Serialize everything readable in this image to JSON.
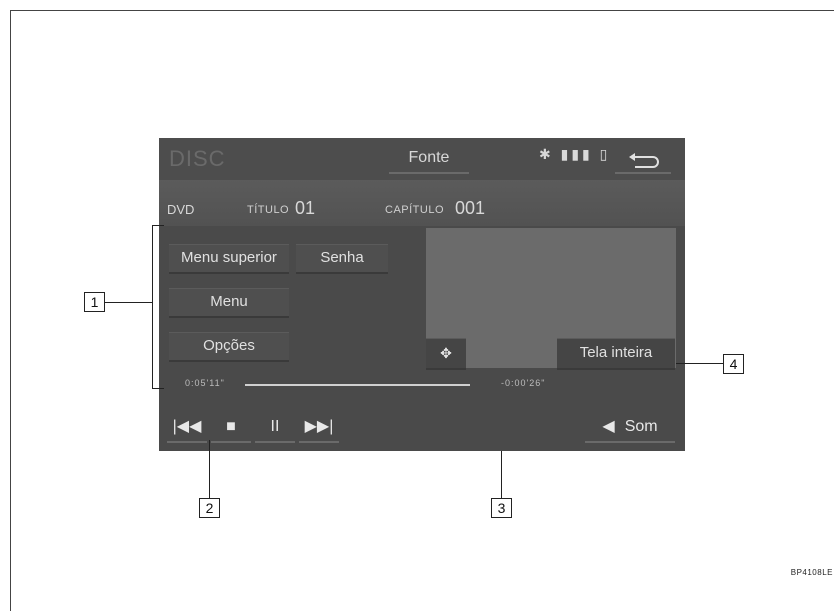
{
  "screen": {
    "title": "DISC",
    "source_button": "Fonte",
    "status_icons": [
      "bluetooth-icon",
      "signal-icon",
      "battery-icon"
    ],
    "back_icon": "back-icon"
  },
  "info": {
    "media": "DVD",
    "title_label": "TÍTULO",
    "title_value": "01",
    "chapter_label": "CAPÍTULO",
    "chapter_value": "001"
  },
  "menu": {
    "top_menu": "Menu superior",
    "password": "Senha",
    "menu": "Menu",
    "options": "Opções",
    "fullscreen": "Tela inteira"
  },
  "progress": {
    "elapsed": "0:05'11\"",
    "remaining": "-0:00'26\""
  },
  "controls": {
    "prev": "|◀◀",
    "stop": "■",
    "pause": "II",
    "next": "▶▶|",
    "sound": "Som"
  },
  "callouts": [
    "1",
    "2",
    "3",
    "4"
  ],
  "doc_code": "BP4108LE"
}
